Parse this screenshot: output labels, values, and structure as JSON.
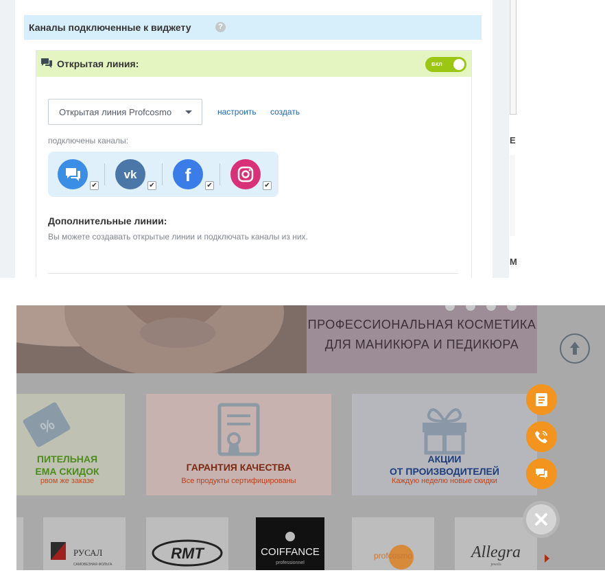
{
  "widget": {
    "section_title": "Каналы подключенные к виджету",
    "help_glyph": "?",
    "open_line": {
      "title": "Открытая линия:",
      "toggle_label": "вкл",
      "toggle_on": true,
      "select_value": "Открытая линия Profcosmo",
      "configure_link": "настроить",
      "create_link": "создать",
      "connected_label": "подключены каналы:",
      "channels": [
        {
          "name": "chat",
          "icon": "chat-bubbles-icon",
          "color": "#3b8ee5",
          "checked": true
        },
        {
          "name": "vk",
          "icon": "vk-icon",
          "color": "#4a76a8",
          "checked": true
        },
        {
          "name": "facebook",
          "icon": "facebook-icon",
          "color": "#3b7de8",
          "checked": true
        },
        {
          "name": "instagram",
          "icon": "instagram-icon",
          "color": "#d93177",
          "checked": true
        }
      ]
    },
    "additional": {
      "title": "Дополнительные линии:",
      "description": "Вы можете создавать открытые линии и подключать каналы из них."
    },
    "right_col_letters": [
      "Е",
      "М"
    ]
  },
  "shop": {
    "banner_line1": "ПРОФЕССИОНАЛЬНАЯ  КОСМЕТИКА",
    "banner_line2": "ДЛЯ МАНИКЮРА И ПЕДИКЮРА",
    "tiles": [
      {
        "line1": "ПИТЕЛЬНАЯ",
        "line2": "ЕМА СКИДОК",
        "sub": "рвом же заказе",
        "color1": "#4d8a1c",
        "color2": "#4d8a1c",
        "sub_color": "#c8461c",
        "bg": "#bfc2b3"
      },
      {
        "line1": "ГАРАНТИЯ КАЧЕСТВА",
        "line2": "",
        "sub": "Все продукты сертифицированы",
        "color1": "#7a2a12",
        "color2": "",
        "sub_color": "#b8401a",
        "bg": "#c7b2b0"
      },
      {
        "line1": "АКЦИИ",
        "line2": "ОТ ПРОИЗВОДИТЕЛЕЙ",
        "sub": "Каждую неделю новые скидки",
        "color1": "#1d3d7a",
        "color2": "#1d3d7a",
        "sub_color": "#c04218",
        "bg": "#b6b6bd"
      }
    ],
    "brands": [
      "РУСАЛ",
      "RMT",
      "COIFFANCE",
      "profcosmo",
      "Allegra"
    ],
    "brand_sub": {
      "rusal": "САМОВЕЗНАЯ ФОЛЬГА",
      "coiffance": "professionnel",
      "allegra": "jewels"
    },
    "fab_buttons": [
      "form-icon",
      "phone-icon",
      "chat-icon"
    ],
    "close_icon": "close-icon"
  }
}
